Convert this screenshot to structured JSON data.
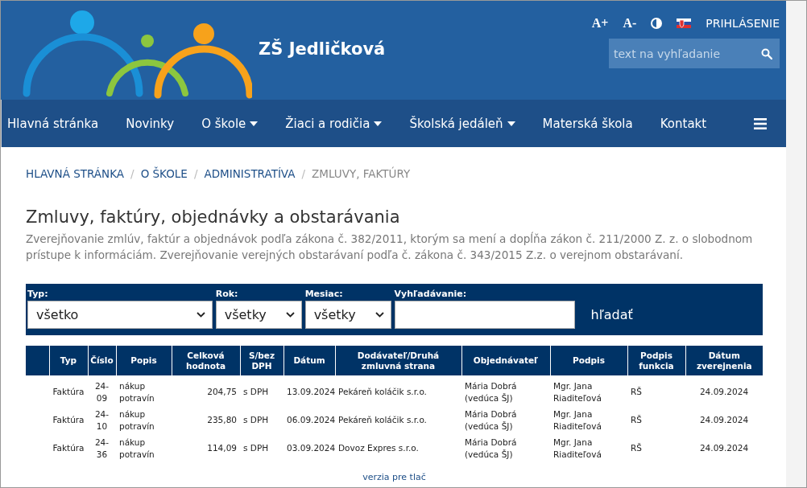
{
  "header": {
    "title": "ZŠ Jedličková",
    "font_controls": [
      "A+",
      "A-"
    ],
    "login": "PRIHLÁSENIE",
    "search": {
      "placeholder": "text na vyhľadanie"
    }
  },
  "nav": {
    "items": [
      {
        "label": "Hlavná stránka",
        "dropdown": false
      },
      {
        "label": "Novinky",
        "dropdown": false
      },
      {
        "label": "O škole",
        "dropdown": true
      },
      {
        "label": "Žiaci a rodičia",
        "dropdown": true
      },
      {
        "label": "Školská jedáleň",
        "dropdown": true
      },
      {
        "label": "Materská škola",
        "dropdown": false
      },
      {
        "label": "Kontakt",
        "dropdown": false
      }
    ]
  },
  "breadcrumb": [
    {
      "label": "HLAVNÁ STRÁNKA",
      "current": false
    },
    {
      "separator": "/",
      "label": "O ŠKOLE",
      "current": false
    },
    {
      "separator": "/",
      "label": "ADMINISTRATÍVA",
      "current": false
    },
    {
      "separator": "/",
      "label": "ZMLUVY, FAKTÚRY",
      "current": true
    }
  ],
  "heading": "Zmluvy, faktúry, objednávky a obstarávania",
  "intro": "Zverejňovanie zmlúv, faktúr a objednávok podľa zákona č. 382/2011, ktorým sa mení a dopĺňa zákon č. 211/2000 Z. z. o slobodnom prístupe k informáciám. Zverejňovanie verejných obstarávaní podľa č. zákona č. 343/2015 Z.z. o verejnom obstarávaní.",
  "filters": [
    {
      "label": "Typ:",
      "kind": "select",
      "value": "všetko"
    },
    {
      "label": "Rok:",
      "kind": "select",
      "value": "všetky"
    },
    {
      "label": "Mesiac:",
      "kind": "select",
      "value": "všetky"
    },
    {
      "label": "Vyhľadávanie:",
      "kind": "text"
    }
  ],
  "search_button": "hľadať",
  "table": {
    "columns": [
      "Typ",
      "Číslo",
      "Popis",
      "Celková hodnota",
      "S/bez DPH",
      "Dátum",
      "Dodávateľ/Druhá zmluvná strana",
      "Objednávateľ",
      "Podpis",
      "Podpis funkcia",
      "Dátum zverejnenia"
    ],
    "rows": [
      [
        "Faktúra",
        "24-09",
        "nákup potravín",
        "204,75",
        "s DPH",
        "13.09.2024",
        "Pekáreň koláčik s.r.o.",
        "Mária Dobrá (vedúca ŠJ)",
        "Mgr. Jana Riaditeľová",
        "RŠ",
        "24.09.2024"
      ],
      [
        "Faktúra",
        "24-10",
        "nákup potravín",
        "235,80",
        "s DPH",
        "06.09.2024",
        "Pekáreň koláčik s.r.o.",
        "Mária Dobrá (vedúca ŠJ)",
        "Mgr. Jana Riaditeľová",
        "RŠ",
        "24.09.2024"
      ],
      [
        "Faktúra",
        "24-36",
        "nákup potravín",
        "114,09",
        "s DPH",
        "03.09.2024",
        "Dovoz Expres s.r.o.",
        "Mária Dobrá (vedúca ŠJ)",
        "Mgr. Jana Riaditeľová",
        "RŠ",
        "24.09.2024"
      ]
    ]
  },
  "print_link": "verzia pre tlač"
}
